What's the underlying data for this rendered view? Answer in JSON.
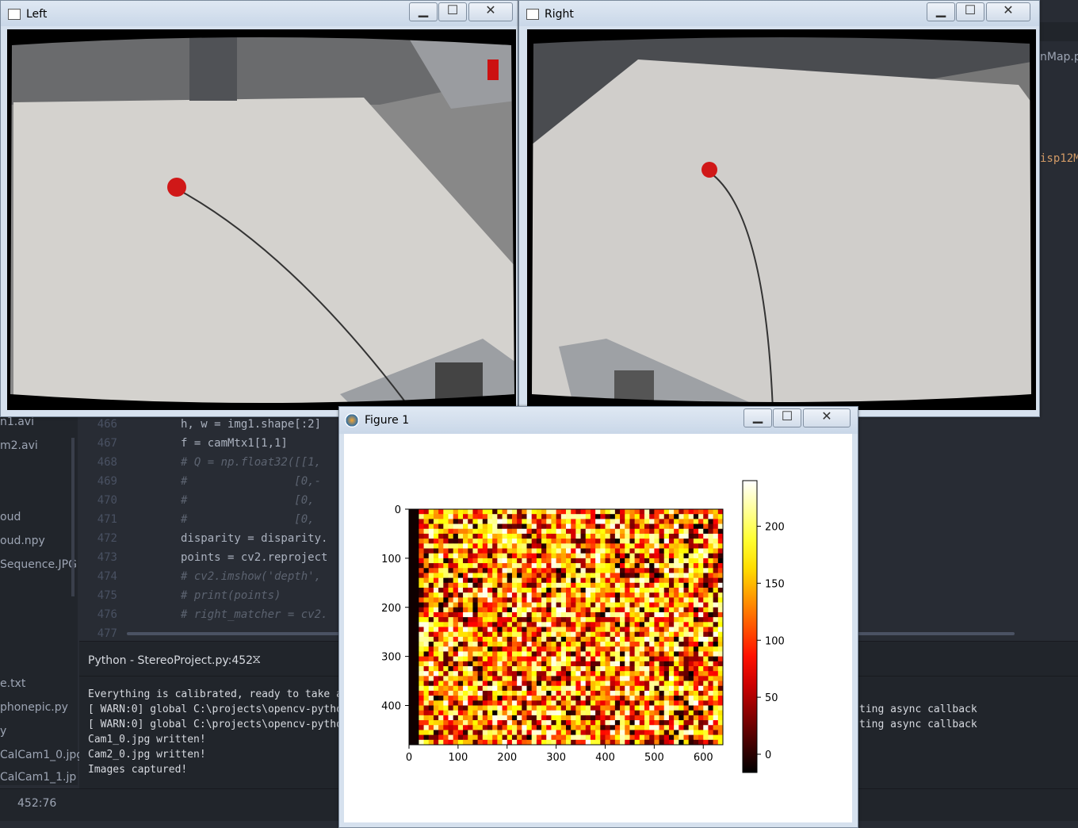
{
  "windows": {
    "left": {
      "title": "Left"
    },
    "right": {
      "title": "Right"
    },
    "figure": {
      "title": "Figure 1"
    }
  },
  "editor": {
    "top_right_tab": "nMap.p",
    "right_snippet": "isp12M",
    "sidebar_items": [
      "n1.avi",
      "m2.avi",
      "oud",
      "oud.npy",
      "Sequence.JPG",
      "e.txt",
      "phonepic.py",
      "y",
      "CalCam1_0.jpg",
      "CalCam1_1.jp"
    ],
    "lines": [
      {
        "num": "466",
        "code": "h, w = img1.shape[:2]"
      },
      {
        "num": "467",
        "code": "f = camMtx1[1,1]"
      },
      {
        "num": "468",
        "code": "# Q = np.float32([[1,"
      },
      {
        "num": "469",
        "code": "#                [0,-"
      },
      {
        "num": "470",
        "code": "#                [0,"
      },
      {
        "num": "471",
        "code": "#                [0,"
      },
      {
        "num": "472",
        "code": "disparity = disparity."
      },
      {
        "num": "473",
        "code": "points = cv2.reproject"
      },
      {
        "num": "474",
        "code": "# cv2.imshow('depth',"
      },
      {
        "num": "475",
        "code": "# print(points)"
      },
      {
        "num": "476",
        "code": "# right_matcher = cv2."
      },
      {
        "num": "477",
        "code": ""
      }
    ],
    "console_title": "Python - StereoProject.py:452",
    "console_lines": [
      "Everything is calibrated, ready to take an",
      "[ WARN:0] global C:\\projects\\opencv-python",
      "[ WARN:0] global C:\\projects\\opencv-python",
      "Cam1_0.jpg written!",
      "Cam2_0.jpg written!",
      "Images captured!"
    ],
    "console_right": [
      "ting async callback",
      "ting async callback"
    ],
    "status": "452:76"
  },
  "chart_data": {
    "type": "heatmap",
    "title": "",
    "x_ticks": [
      "0",
      "100",
      "200",
      "300",
      "400",
      "500",
      "600"
    ],
    "y_ticks": [
      "0",
      "100",
      "200",
      "300",
      "400"
    ],
    "xlim": [
      0,
      640
    ],
    "ylim": [
      480,
      0
    ],
    "colormap": "hot",
    "colorbar_ticks": [
      "0",
      "50",
      "100",
      "150",
      "200"
    ],
    "colorbar_range": [
      -16,
      240
    ]
  },
  "colors": {
    "editor_bg": "#282c34",
    "titlebar": "#d6e1ee"
  }
}
